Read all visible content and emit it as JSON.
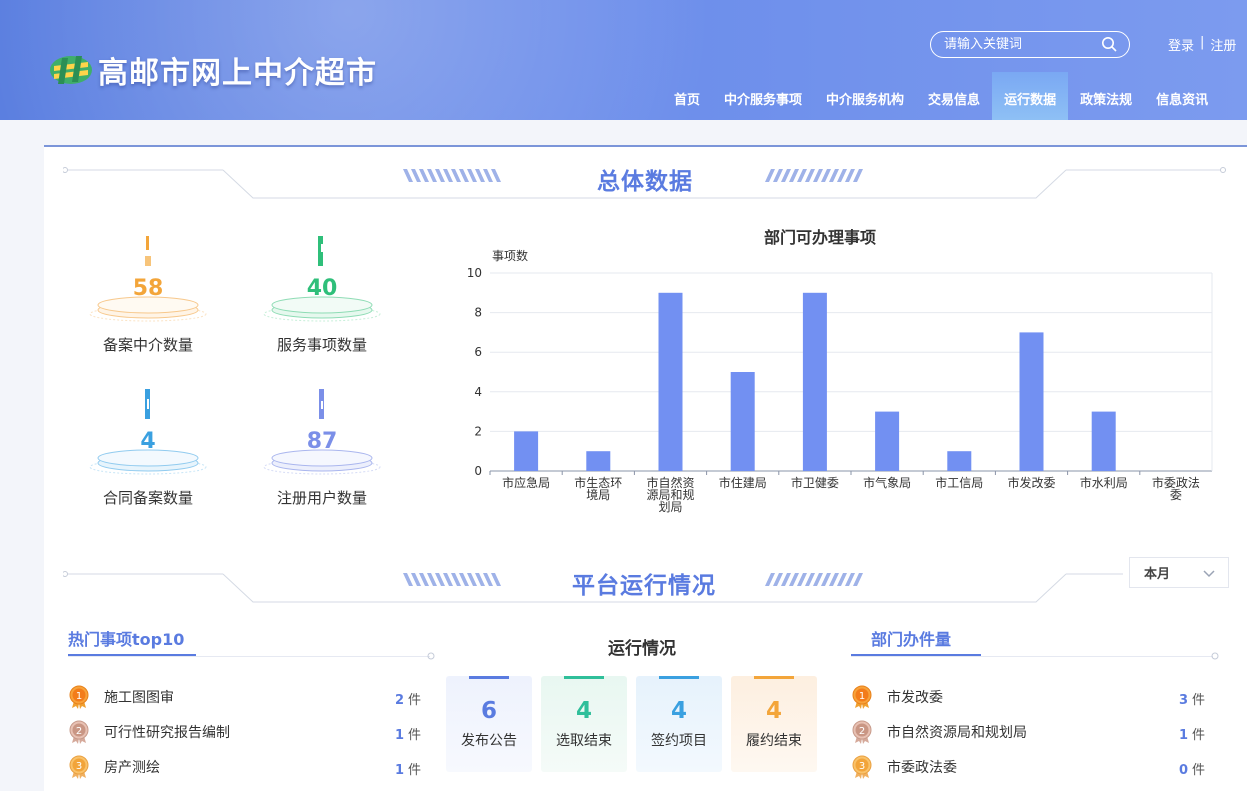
{
  "header": {
    "site_title": "高邮市网上中介超市",
    "search_placeholder": "请输入关键词",
    "login": "登录",
    "separator": "|",
    "register": "注册",
    "nav": [
      {
        "label": "首页",
        "active": false
      },
      {
        "label": "中介服务事项",
        "active": false
      },
      {
        "label": "中介服务机构",
        "active": false
      },
      {
        "label": "交易信息",
        "active": false
      },
      {
        "label": "运行数据",
        "active": true
      },
      {
        "label": "政策法规",
        "active": false
      },
      {
        "label": "信息资讯",
        "active": false
      }
    ]
  },
  "overall": {
    "section_title": "总体数据",
    "stats": [
      {
        "value": "58",
        "label": "备案中介数量",
        "color": "#f3a53a",
        "icon": "bar-icon-orange"
      },
      {
        "value": "40",
        "label": "服务事项数量",
        "color": "#2fbf7a",
        "icon": "bar-icon-green"
      },
      {
        "value": "4",
        "label": "合同备案数量",
        "color": "#3aa0e0",
        "icon": "bar-icon-blue"
      },
      {
        "value": "87",
        "label": "注册用户数量",
        "color": "#7b8fe8",
        "icon": "bar-icon-purple"
      }
    ]
  },
  "chart_data": {
    "type": "bar",
    "title": "部门可办理事项",
    "ylabel": "事项数",
    "xlabel": "",
    "ylim": [
      0,
      10
    ],
    "yticks": [
      0,
      2,
      4,
      6,
      8,
      10
    ],
    "categories": [
      "市应急局",
      "市生态环境局",
      "市自然资源局和规划局",
      "市住建局",
      "市卫健委",
      "市气象局",
      "市工信局",
      "市发改委",
      "市水利局",
      "市委政法委"
    ],
    "tick_lines": [
      [
        "市应急局"
      ],
      [
        "市生态环",
        "境局"
      ],
      [
        "市自然资",
        "源局和规",
        "划局"
      ],
      [
        "市住建局"
      ],
      [
        "市卫健委"
      ],
      [
        "市气象局"
      ],
      [
        "市工信局"
      ],
      [
        "市发改委"
      ],
      [
        "市水利局"
      ],
      [
        "市委政法",
        "委"
      ]
    ],
    "values": [
      2,
      1,
      9,
      5,
      9,
      3,
      1,
      7,
      3,
      0
    ],
    "bar_color": "#7290f2",
    "grid": true
  },
  "platform": {
    "section_title": "平台运行情况",
    "period_select": "本月",
    "hot": {
      "title": "热门事项top10",
      "unit": "件",
      "items": [
        {
          "rank": "1",
          "name": "施工图图审",
          "count": "2"
        },
        {
          "rank": "2",
          "name": "可行性研究报告编制",
          "count": "1"
        },
        {
          "rank": "3",
          "name": "房产测绘",
          "count": "1"
        }
      ]
    },
    "run": {
      "title": "运行情况",
      "cards": [
        {
          "value": "6",
          "label": "发布公告",
          "color": "#5a7be0",
          "bg": "#eef2fd"
        },
        {
          "value": "4",
          "label": "选取结束",
          "color": "#2fbf9a",
          "bg": "#ebf8f3"
        },
        {
          "value": "4",
          "label": "签约项目",
          "color": "#3aa0e0",
          "bg": "#eaf4fc"
        },
        {
          "value": "4",
          "label": "履约结束",
          "color": "#f3a53a",
          "bg": "#fdf2e6"
        }
      ]
    },
    "dept": {
      "title": "部门办件量",
      "unit": "件",
      "items": [
        {
          "rank": "1",
          "name": "市发改委",
          "count": "3"
        },
        {
          "rank": "2",
          "name": "市自然资源局和规划局",
          "count": "1"
        },
        {
          "rank": "3",
          "name": "市委政法委",
          "count": "0"
        }
      ]
    }
  }
}
